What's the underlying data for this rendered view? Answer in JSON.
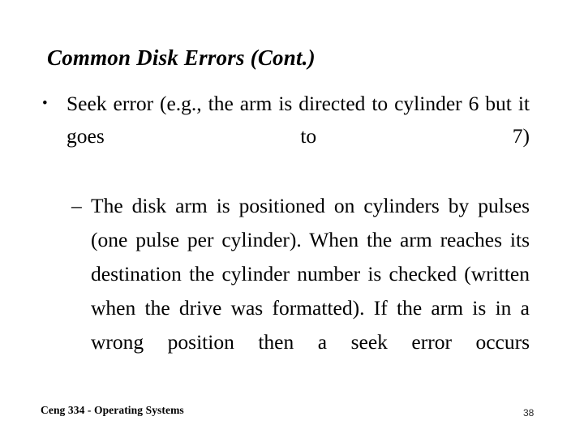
{
  "slide": {
    "title": "Common Disk Errors (Cont.)",
    "bullets": [
      {
        "level": 1,
        "marker": "•",
        "marker_name": "round-bullet",
        "text": "Seek error (e.g., the arm is directed to cylinder 6 but it goes to 7)"
      },
      {
        "level": 2,
        "marker": "–",
        "marker_name": "en-dash-bullet",
        "text": "The disk arm is positioned on cylinders by pulses (one pulse per cylinder). When the arm reaches its destination the cylinder number is checked (written when the drive was formatted). If the arm is in a wrong position then a seek error occurs"
      }
    ],
    "footer": {
      "course": "Ceng 334 - Operating Systems",
      "page_number": "38"
    },
    "colors": {
      "background": "#ffffff",
      "text": "#000000",
      "page_number": "#2b2b2b"
    }
  }
}
